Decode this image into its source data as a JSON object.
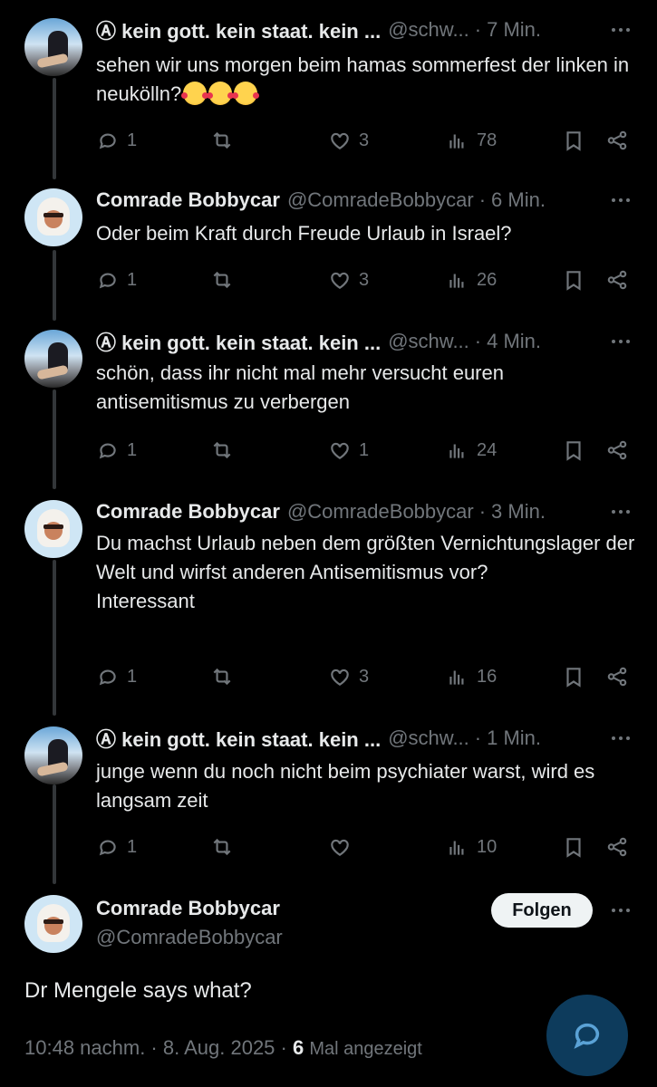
{
  "replies": [
    {
      "author": "Ⓐ kein gott. kein staat. kein ...",
      "handle": "@schw...",
      "time": "7 Min.",
      "text": "sehen wir uns morgen beim hamas sommerfest der linken in neukölln?",
      "emojis": [
        "smiling-face-with-hearts",
        "smiling-face-with-hearts",
        "smiling-face-with-hearts"
      ],
      "replies": "1",
      "reposts": "",
      "likes": "3",
      "views": "78"
    },
    {
      "author": "Comrade Bobbycar",
      "handle": "@ComradeBobbycar",
      "time": "6 Min.",
      "text": "Oder beim Kraft durch Freude Urlaub in Israel?",
      "replies": "1",
      "reposts": "",
      "likes": "3",
      "views": "26"
    },
    {
      "author": "Ⓐ kein gott. kein staat. kein ...",
      "handle": "@schw...",
      "time": "4 Min.",
      "text": "schön, dass ihr nicht mal mehr versucht euren antisemitismus zu verbergen",
      "replies": "1",
      "reposts": "",
      "likes": "1",
      "views": "24"
    },
    {
      "author": "Comrade Bobbycar",
      "handle": "@ComradeBobbycar",
      "time": "3 Min.",
      "text": "Du machst Urlaub neben dem größten Vernichtungslager der Welt und wirfst anderen Antisemitismus vor?\nInteressant",
      "replies": "1",
      "reposts": "",
      "likes": "3",
      "views": "16"
    },
    {
      "author": "Ⓐ kein gott. kein staat. kein ...",
      "handle": "@schw...",
      "time": "1 Min.",
      "text": "junge wenn du noch nicht beim psychiater warst, wird es langsam zeit",
      "replies": "1",
      "reposts": "",
      "likes": "",
      "views": "10"
    }
  ],
  "main": {
    "author": "Comrade Bobbycar",
    "handle": "@ComradeBobbycar",
    "follow_label": "Folgen",
    "text": "Dr Mengele says what?",
    "timestamp": "10:48 nachm. · 8. Aug. 2025 · ",
    "view_count": "6",
    "view_label": "Mal angezeigt"
  },
  "icons": {
    "reply": "reply-icon",
    "repost": "repost-icon",
    "like": "heart-icon",
    "views": "views-icon",
    "bookmark": "bookmark-icon",
    "share": "share-icon",
    "more": "more-icon",
    "compose": "reply-compose-icon"
  },
  "colors": {
    "background": "#000000",
    "text": "#e7e9ea",
    "muted": "#71767b",
    "thread_line": "#333639",
    "fab": "#0d3b5c"
  }
}
